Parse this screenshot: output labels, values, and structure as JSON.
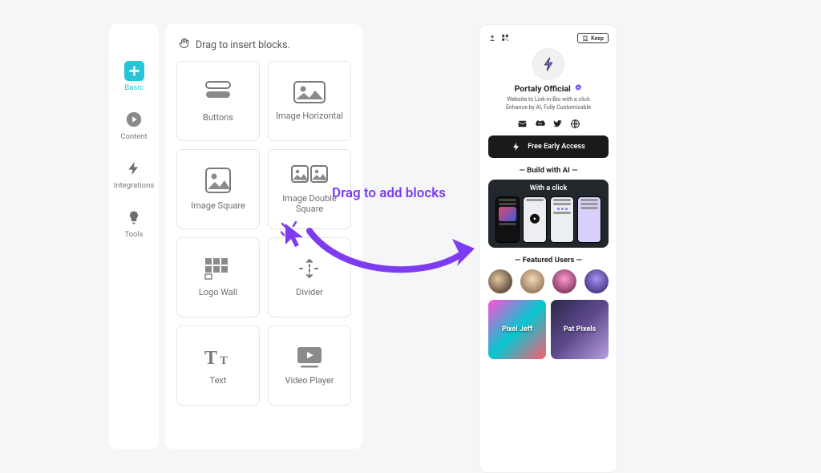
{
  "sidebar": {
    "items": [
      {
        "label": "Basic"
      },
      {
        "label": "Content"
      },
      {
        "label": "Integrations"
      },
      {
        "label": "Tools"
      }
    ]
  },
  "blocks_panel": {
    "header": "Drag to insert blocks.",
    "tiles": [
      {
        "label": "Buttons",
        "icon": "buttons"
      },
      {
        "label": "Image Horizontal",
        "icon": "image-h"
      },
      {
        "label": "Image Square",
        "icon": "image-sq"
      },
      {
        "label": "Image Double Square",
        "icon": "image-double"
      },
      {
        "label": "Logo Wall",
        "icon": "logo-wall"
      },
      {
        "label": "Divider",
        "icon": "divider"
      },
      {
        "label": "Text",
        "icon": "text"
      },
      {
        "label": "Video Player",
        "icon": "video"
      }
    ]
  },
  "drag_hint": {
    "label": "Drag to add blocks"
  },
  "preview": {
    "keep_button": "Keep",
    "profile": {
      "name": "Portaly Official",
      "tagline_line1": "Website to Link-in-Bio with a click",
      "tagline_line2": "Enhance by AI, Fully Customizable"
    },
    "cta": "Free Early Access",
    "section_build": "Build with AI",
    "ai_card_title": "With a click",
    "section_users": "Featured Users",
    "user_cards": [
      {
        "label": "Pixel Jeff"
      },
      {
        "label": "Pat Pixels"
      }
    ]
  }
}
